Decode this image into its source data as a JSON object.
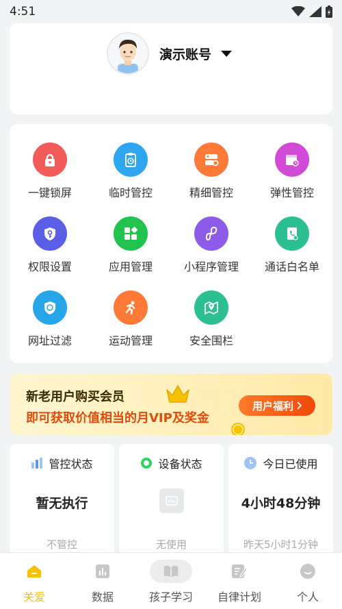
{
  "status_bar": {
    "time": "4:51"
  },
  "profile": {
    "account_name": "演示账号"
  },
  "features": [
    {
      "label": "一键锁屏",
      "icon": "lock-icon",
      "color": "#f35b5b"
    },
    {
      "label": "临时管控",
      "icon": "timer-clipboard-icon",
      "color": "#2fa7f0"
    },
    {
      "label": "精细管控",
      "icon": "fine-control-icon",
      "color": "#ff7a36"
    },
    {
      "label": "弹性管控",
      "icon": "calendar-clock-icon",
      "color": "#d14bd6"
    },
    {
      "label": "权限设置",
      "icon": "shield-key-icon",
      "color": "#5b5ee6"
    },
    {
      "label": "应用管理",
      "icon": "apps-grid-icon",
      "color": "#22c24f"
    },
    {
      "label": "小程序管理",
      "icon": "mini-program-icon",
      "color": "#8d5ce8"
    },
    {
      "label": "通话白名单",
      "icon": "phone-book-icon",
      "color": "#2bbf92"
    },
    {
      "label": "网址过滤",
      "icon": "shield-compass-icon",
      "color": "#26a6e8"
    },
    {
      "label": "运动管理",
      "icon": "running-icon",
      "color": "#ff7a36"
    },
    {
      "label": "安全围栏",
      "icon": "map-pin-icon",
      "color": "#2bbf92"
    }
  ],
  "promo": {
    "line1": "新老用户购买会员",
    "line2": "即可获取价值相当的月VIP及奖金",
    "button": "用户福利"
  },
  "stats": [
    {
      "title": "管控状态",
      "value": "暂无执行",
      "sub": "不管控",
      "icon": "bar-chart-icon"
    },
    {
      "title": "设备状态",
      "value": "",
      "sub": "无使用",
      "icon": "status-dot-icon"
    },
    {
      "title": "今日已使用",
      "value": "4小时48分钟",
      "sub": "昨天5小时1分钟",
      "icon": "clock-icon"
    }
  ],
  "tabs": [
    {
      "label": "关爱",
      "icon": "home-icon",
      "active": true
    },
    {
      "label": "数据",
      "icon": "data-chart-icon",
      "active": false
    },
    {
      "label": "孩子学习",
      "icon": "book-icon",
      "active": false
    },
    {
      "label": "自律计划",
      "icon": "plan-edit-icon",
      "active": false
    },
    {
      "label": "个人",
      "icon": "person-icon",
      "active": false
    }
  ],
  "colors": {
    "accent": "#f7c100",
    "promo_text": "#e04a0a",
    "background": "#f2f3f5"
  }
}
